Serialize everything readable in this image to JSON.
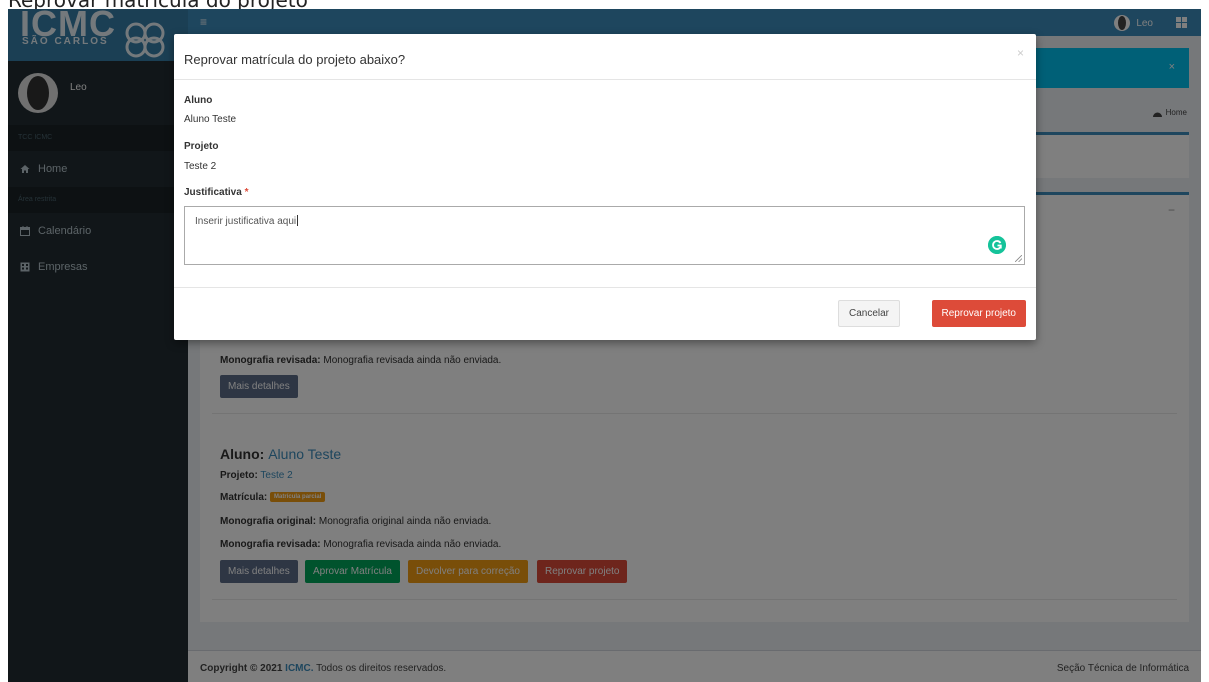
{
  "caption": "Reprovar matrícula do projeto",
  "sidebar": {
    "logo_text": "ICMC",
    "logo_subtitle": "SÃO CARLOS",
    "user_name": "Leo",
    "section_1": "TCC ICMC",
    "section_2": "Área restrita",
    "items": [
      {
        "label": "Home",
        "icon": "home-icon"
      },
      {
        "label": "Calendário",
        "icon": "calendar-icon"
      },
      {
        "label": "Empresas",
        "icon": "building-icon"
      }
    ]
  },
  "navbar": {
    "user_name": "Leo"
  },
  "content": {
    "breadcrumb": "Home",
    "entry_1": {
      "monografia_revisada_label": "Monografia revisada:",
      "monografia_revisada_value": "Monografia revisada ainda não enviada.",
      "details_button": "Mais detalhes"
    },
    "entry_2": {
      "aluno_label": "Aluno:",
      "aluno_value": "Aluno Teste",
      "projeto_label": "Projeto:",
      "projeto_value": "Teste 2",
      "matricula_label": "Matrícula:",
      "matricula_badge": "Matrícula parcial",
      "monografia_original_label": "Monografia original:",
      "monografia_original_value": "Monografia original ainda não enviada.",
      "monografia_revisada_label": "Monografia revisada:",
      "monografia_revisada_value": "Monografia revisada ainda não enviada.",
      "buttons": {
        "details": "Mais detalhes",
        "approve": "Aprovar Matrícula",
        "return": "Devolver para correção",
        "reject": "Reprovar projeto"
      }
    }
  },
  "footer": {
    "copyright_prefix": "Copyright © 2021",
    "org": "ICMC.",
    "rights": "Todos os direitos reservados.",
    "right_text": "Seção Técnica de Informática"
  },
  "modal": {
    "title": "Reprovar matrícula do projeto abaixo?",
    "close": "×",
    "aluno_label": "Aluno",
    "aluno_value": "Aluno Teste",
    "projeto_label": "Projeto",
    "projeto_value": "Teste 2",
    "justificativa_label": "Justificativa",
    "required_mark": "*",
    "justificativa_value": "Inserir justificativa aqui",
    "cancel_button": "Cancelar",
    "confirm_button": "Reprovar projeto"
  },
  "colors": {
    "primary": "#3c8dbc",
    "sidebar": "#222d32",
    "danger": "#dd4b39",
    "success": "#00a65a",
    "warning": "#f39c12",
    "info": "#00c0ef"
  }
}
